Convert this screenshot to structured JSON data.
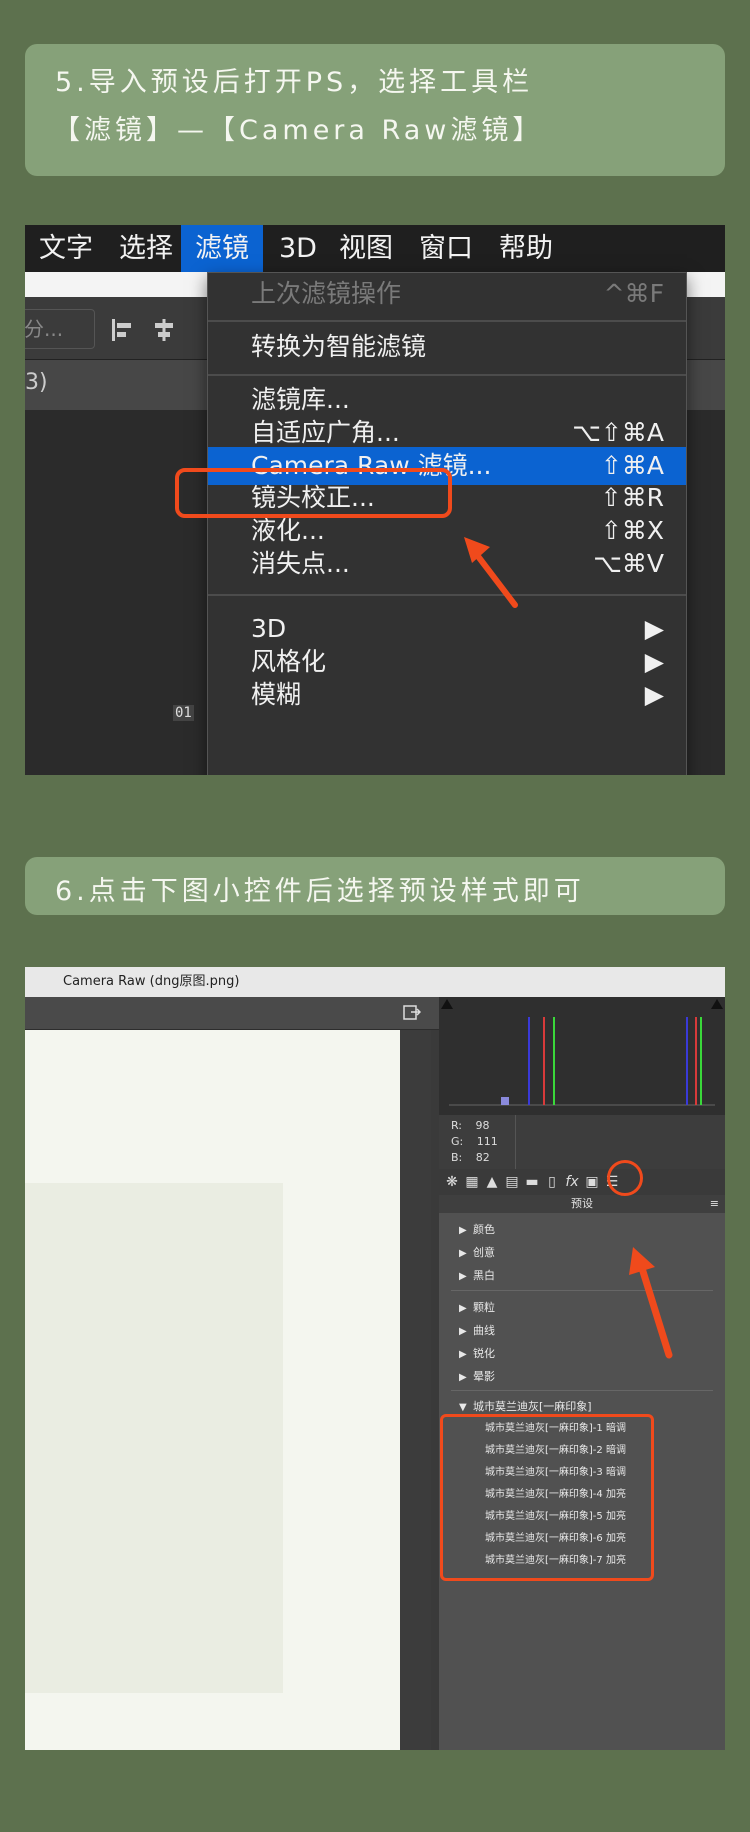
{
  "step5": {
    "line1": "5.导入预设后打开PS，选择工具栏",
    "line2": "【滤镜】—【Camera Raw滤镜】"
  },
  "ps": {
    "menubar": [
      "文字",
      "选择",
      "滤镜",
      "3D",
      "视图",
      "窗口",
      "帮助"
    ],
    "active_menu": "滤镜",
    "search_placeholder": "分...",
    "tab_fragment": "3)",
    "layer_tag": "01",
    "filter_menu": [
      {
        "label": "上次滤镜操作",
        "shortcut": "^⌘F",
        "disabled": true
      },
      {
        "label": "转换为智能滤镜",
        "shortcut": ""
      },
      {
        "label": "滤镜库...",
        "shortcut": ""
      },
      {
        "label": "自适应广角...",
        "shortcut": "⌥⇧⌘A"
      },
      {
        "label": "Camera Raw 滤镜...",
        "shortcut": "⇧⌘A",
        "highlighted": true
      },
      {
        "label": "镜头校正...",
        "shortcut": "⇧⌘R"
      },
      {
        "label": "液化...",
        "shortcut": "⇧⌘X"
      },
      {
        "label": "消失点...",
        "shortcut": "⌥⌘V"
      },
      {
        "label": "3D",
        "shortcut": "▶"
      },
      {
        "label": "风格化",
        "shortcut": "▶"
      },
      {
        "label": "模糊",
        "shortcut": "▶"
      }
    ]
  },
  "step6": {
    "line1": "6.点击下图小控件后选择预设样式即可"
  },
  "cr": {
    "window_title": "Camera Raw (dng原图.png)",
    "rgb": {
      "r_label": "R:",
      "r": "98",
      "g_label": "G:",
      "g": "111",
      "b_label": "B:",
      "b": "82"
    },
    "fx_label": "fx",
    "presets_title": "预设",
    "groups": [
      "颜色",
      "创意",
      "黑白",
      "颗粒",
      "曲线",
      "锐化",
      "晕影"
    ],
    "open_group": "城市莫兰迪灰[一麻印象]",
    "presets": [
      "城市莫兰迪灰[一麻印象]-1 暗调",
      "城市莫兰迪灰[一麻印象]-2 暗调",
      "城市莫兰迪灰[一麻印象]-3 暗调",
      "城市莫兰迪灰[一麻印象]-4 加亮",
      "城市莫兰迪灰[一麻印象]-5 加亮",
      "城市莫兰迪灰[一麻印象]-6 加亮",
      "城市莫兰迪灰[一麻印象]-7 加亮"
    ]
  },
  "colors": {
    "background": "#5d714e",
    "card": "#86a179",
    "highlight": "#0b63d1",
    "callout": "#f04a1c"
  }
}
